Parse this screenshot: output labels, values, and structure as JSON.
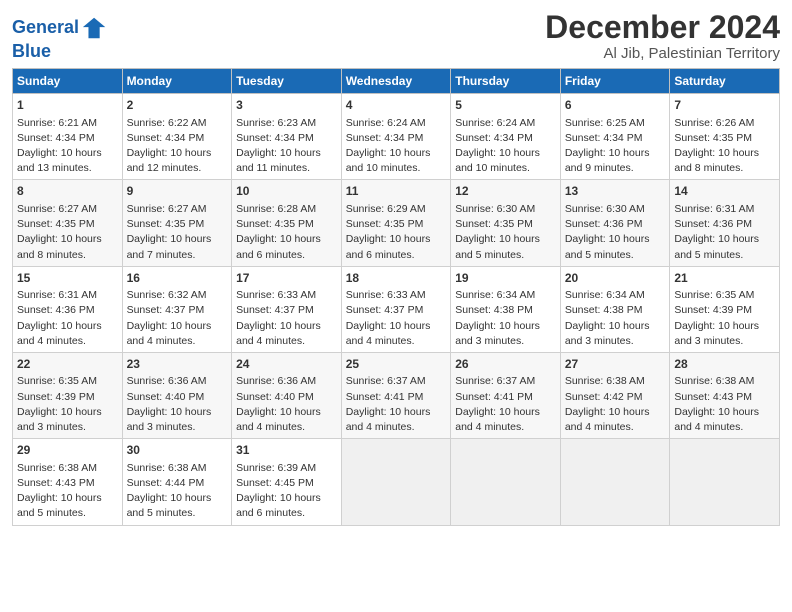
{
  "logo": {
    "line1": "General",
    "line2": "Blue"
  },
  "title": "December 2024",
  "subtitle": "Al Jib, Palestinian Territory",
  "days_header": [
    "Sunday",
    "Monday",
    "Tuesday",
    "Wednesday",
    "Thursday",
    "Friday",
    "Saturday"
  ],
  "weeks": [
    [
      {
        "day": "1",
        "sun": "6:21 AM",
        "set": "4:34 PM",
        "light": "10 hours and 13 minutes."
      },
      {
        "day": "2",
        "sun": "6:22 AM",
        "set": "4:34 PM",
        "light": "10 hours and 12 minutes."
      },
      {
        "day": "3",
        "sun": "6:23 AM",
        "set": "4:34 PM",
        "light": "10 hours and 11 minutes."
      },
      {
        "day": "4",
        "sun": "6:24 AM",
        "set": "4:34 PM",
        "light": "10 hours and 10 minutes."
      },
      {
        "day": "5",
        "sun": "6:24 AM",
        "set": "4:34 PM",
        "light": "10 hours and 10 minutes."
      },
      {
        "day": "6",
        "sun": "6:25 AM",
        "set": "4:34 PM",
        "light": "10 hours and 9 minutes."
      },
      {
        "day": "7",
        "sun": "6:26 AM",
        "set": "4:35 PM",
        "light": "10 hours and 8 minutes."
      }
    ],
    [
      {
        "day": "8",
        "sun": "6:27 AM",
        "set": "4:35 PM",
        "light": "10 hours and 8 minutes."
      },
      {
        "day": "9",
        "sun": "6:27 AM",
        "set": "4:35 PM",
        "light": "10 hours and 7 minutes."
      },
      {
        "day": "10",
        "sun": "6:28 AM",
        "set": "4:35 PM",
        "light": "10 hours and 6 minutes."
      },
      {
        "day": "11",
        "sun": "6:29 AM",
        "set": "4:35 PM",
        "light": "10 hours and 6 minutes."
      },
      {
        "day": "12",
        "sun": "6:30 AM",
        "set": "4:35 PM",
        "light": "10 hours and 5 minutes."
      },
      {
        "day": "13",
        "sun": "6:30 AM",
        "set": "4:36 PM",
        "light": "10 hours and 5 minutes."
      },
      {
        "day": "14",
        "sun": "6:31 AM",
        "set": "4:36 PM",
        "light": "10 hours and 5 minutes."
      }
    ],
    [
      {
        "day": "15",
        "sun": "6:31 AM",
        "set": "4:36 PM",
        "light": "10 hours and 4 minutes."
      },
      {
        "day": "16",
        "sun": "6:32 AM",
        "set": "4:37 PM",
        "light": "10 hours and 4 minutes."
      },
      {
        "day": "17",
        "sun": "6:33 AM",
        "set": "4:37 PM",
        "light": "10 hours and 4 minutes."
      },
      {
        "day": "18",
        "sun": "6:33 AM",
        "set": "4:37 PM",
        "light": "10 hours and 4 minutes."
      },
      {
        "day": "19",
        "sun": "6:34 AM",
        "set": "4:38 PM",
        "light": "10 hours and 3 minutes."
      },
      {
        "day": "20",
        "sun": "6:34 AM",
        "set": "4:38 PM",
        "light": "10 hours and 3 minutes."
      },
      {
        "day": "21",
        "sun": "6:35 AM",
        "set": "4:39 PM",
        "light": "10 hours and 3 minutes."
      }
    ],
    [
      {
        "day": "22",
        "sun": "6:35 AM",
        "set": "4:39 PM",
        "light": "10 hours and 3 minutes."
      },
      {
        "day": "23",
        "sun": "6:36 AM",
        "set": "4:40 PM",
        "light": "10 hours and 3 minutes."
      },
      {
        "day": "24",
        "sun": "6:36 AM",
        "set": "4:40 PM",
        "light": "10 hours and 4 minutes."
      },
      {
        "day": "25",
        "sun": "6:37 AM",
        "set": "4:41 PM",
        "light": "10 hours and 4 minutes."
      },
      {
        "day": "26",
        "sun": "6:37 AM",
        "set": "4:41 PM",
        "light": "10 hours and 4 minutes."
      },
      {
        "day": "27",
        "sun": "6:38 AM",
        "set": "4:42 PM",
        "light": "10 hours and 4 minutes."
      },
      {
        "day": "28",
        "sun": "6:38 AM",
        "set": "4:43 PM",
        "light": "10 hours and 4 minutes."
      }
    ],
    [
      {
        "day": "29",
        "sun": "6:38 AM",
        "set": "4:43 PM",
        "light": "10 hours and 5 minutes."
      },
      {
        "day": "30",
        "sun": "6:38 AM",
        "set": "4:44 PM",
        "light": "10 hours and 5 minutes."
      },
      {
        "day": "31",
        "sun": "6:39 AM",
        "set": "4:45 PM",
        "light": "10 hours and 6 minutes."
      },
      null,
      null,
      null,
      null
    ]
  ],
  "labels": {
    "sunrise": "Sunrise:",
    "sunset": "Sunset:",
    "daylight": "Daylight:"
  }
}
